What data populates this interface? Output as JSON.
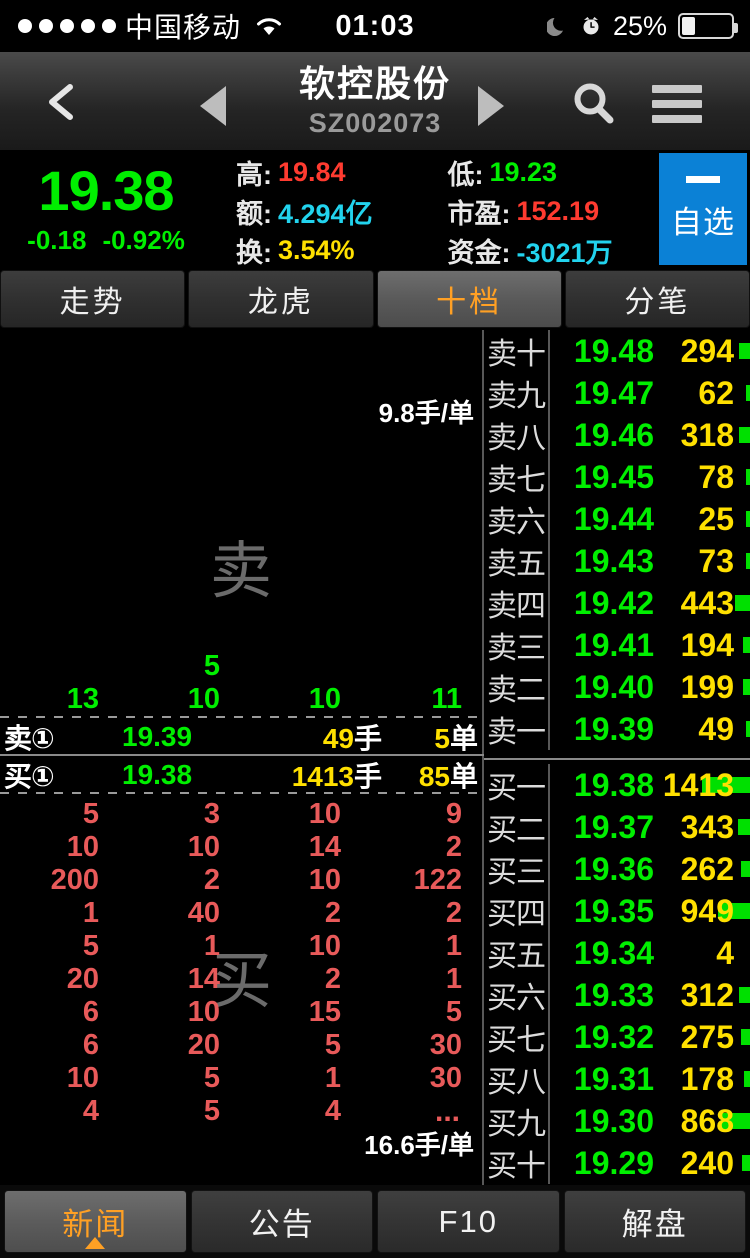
{
  "statusbar": {
    "signal_dots": 5,
    "carrier": "中国移动",
    "wifi_icon": "wifi-icon",
    "time": "01:03",
    "dnd_icon": "moon-icon",
    "alarm_icon": "alarm-clock-icon",
    "battery_pct": "25%",
    "battery_level": 25
  },
  "navbar": {
    "back_icon": "chevron-left-icon",
    "prev_icon": "triangle-left-icon",
    "next_icon": "triangle-right-icon",
    "title": "软控股份",
    "subtitle": "SZ002073",
    "search_icon": "search-icon",
    "menu_icon": "hamburger-menu-icon"
  },
  "quote": {
    "last_price": "19.38",
    "change": "-0.18",
    "change_pct": "-0.92%",
    "color_up": "#ff3b30",
    "color_down": "#00ef00",
    "color_yellow": "#ffe000",
    "color_cyan": "#22d3ee",
    "stats": [
      {
        "label": "高:",
        "value": "19.84",
        "color": "#ff3b30"
      },
      {
        "label": "低:",
        "value": "19.23",
        "color": "#00ef00"
      },
      {
        "label": "额:",
        "value": "4.294亿",
        "color": "#22d3ee"
      },
      {
        "label": "市盈:",
        "value": "152.19",
        "color": "#ff3b30"
      },
      {
        "label": "换:",
        "value": "3.54%",
        "color": "#ffe000"
      },
      {
        "label": "资金:",
        "value": "-3021万",
        "color": "#22d3ee"
      }
    ],
    "fav_button": {
      "minus_icon": "minus-icon",
      "label": "自选"
    }
  },
  "tabs": [
    {
      "label": "走势",
      "active": false
    },
    {
      "label": "龙虎",
      "active": false
    },
    {
      "label": "十档",
      "active": true
    },
    {
      "label": "分笔",
      "active": false
    }
  ],
  "detail": {
    "sell_watermark": "卖",
    "buy_watermark": "买",
    "sell_per_order": "9.8手/单",
    "buy_per_order": "16.6手/单",
    "ellipsis": "...",
    "sell_grid": [
      [
        "",
        "5",
        "",
        ""
      ],
      [
        "13",
        "10",
        "10",
        "11"
      ]
    ],
    "buy_grid": [
      [
        "5",
        "3",
        "10",
        "9"
      ],
      [
        "10",
        "10",
        "14",
        "2"
      ],
      [
        "200",
        "2",
        "10",
        "122"
      ],
      [
        "1",
        "40",
        "2",
        "2"
      ],
      [
        "5",
        "1",
        "10",
        "1"
      ],
      [
        "20",
        "14",
        "2",
        "1"
      ],
      [
        "6",
        "10",
        "15",
        "5"
      ],
      [
        "6",
        "20",
        "5",
        "30"
      ],
      [
        "10",
        "5",
        "1",
        "30"
      ],
      [
        "4",
        "5",
        "4",
        ""
      ]
    ],
    "best_ask": {
      "lead": "卖①",
      "price": "19.39",
      "vol": "49",
      "vol_unit": "手",
      "cnt": "5",
      "cnt_unit": "单"
    },
    "best_bid": {
      "lead": "买①",
      "price": "19.38",
      "vol": "1413",
      "vol_unit": "手",
      "cnt": "85",
      "cnt_unit": "单"
    }
  },
  "orderbook": {
    "asks": [
      {
        "label": "卖十",
        "price": "19.48",
        "vol": "294",
        "bar": 0.22
      },
      {
        "label": "卖九",
        "price": "19.47",
        "vol": "62",
        "bar": 0.05
      },
      {
        "label": "卖八",
        "price": "19.46",
        "vol": "318",
        "bar": 0.23
      },
      {
        "label": "卖七",
        "price": "19.45",
        "vol": "78",
        "bar": 0.06
      },
      {
        "label": "卖六",
        "price": "19.44",
        "vol": "25",
        "bar": 0.02
      },
      {
        "label": "卖五",
        "price": "19.43",
        "vol": "73",
        "bar": 0.05
      },
      {
        "label": "卖四",
        "price": "19.42",
        "vol": "443",
        "bar": 0.31
      },
      {
        "label": "卖三",
        "price": "19.41",
        "vol": "194",
        "bar": 0.14
      },
      {
        "label": "卖二",
        "price": "19.40",
        "vol": "199",
        "bar": 0.14
      },
      {
        "label": "卖一",
        "price": "19.39",
        "vol": "49",
        "bar": 0.03
      }
    ],
    "bids": [
      {
        "label": "买一",
        "price": "19.38",
        "vol": "1413",
        "bar": 1.0
      },
      {
        "label": "买二",
        "price": "19.37",
        "vol": "343",
        "bar": 0.24
      },
      {
        "label": "买三",
        "price": "19.36",
        "vol": "262",
        "bar": 0.19
      },
      {
        "label": "买四",
        "price": "19.35",
        "vol": "949",
        "bar": 0.67
      },
      {
        "label": "买五",
        "price": "19.34",
        "vol": "4",
        "bar": 0.0
      },
      {
        "label": "买六",
        "price": "19.33",
        "vol": "312",
        "bar": 0.22
      },
      {
        "label": "买七",
        "price": "19.32",
        "vol": "275",
        "bar": 0.19
      },
      {
        "label": "买八",
        "price": "19.31",
        "vol": "178",
        "bar": 0.13
      },
      {
        "label": "买九",
        "price": "19.30",
        "vol": "868",
        "bar": 0.61
      },
      {
        "label": "买十",
        "price": "19.29",
        "vol": "240",
        "bar": 0.17
      }
    ]
  },
  "bottomnav": [
    {
      "label": "新闻",
      "active": true
    },
    {
      "label": "公告",
      "active": false
    },
    {
      "label": "F10",
      "active": false
    },
    {
      "label": "解盘",
      "active": false
    }
  ]
}
